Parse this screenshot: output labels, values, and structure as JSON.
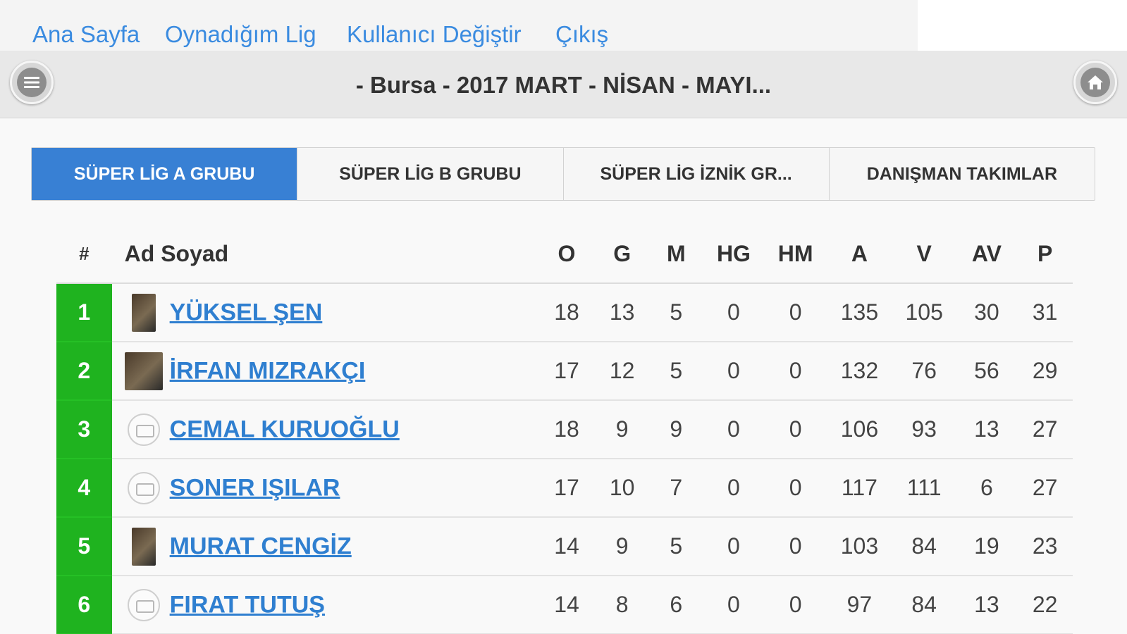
{
  "topnav": {
    "links": [
      "Ana Sayfa",
      "Oynadığım Lig",
      "Kullanıcı Değiştir",
      "Çıkış"
    ]
  },
  "header": {
    "title": "- Bursa - 2017 MART - NİSAN - MAYI...",
    "menu_icon": "hamburger-icon",
    "home_icon": "home-icon"
  },
  "tabs": [
    {
      "label": "SÜPER LİG A GRUBU",
      "active": true
    },
    {
      "label": "SÜPER LİG B GRUBU",
      "active": false
    },
    {
      "label": "SÜPER LİG İZNİK GR...",
      "active": false
    },
    {
      "label": "DANIŞMAN TAKIMLAR",
      "active": false
    }
  ],
  "table": {
    "headers": [
      "#",
      "Ad Soyad",
      "O",
      "G",
      "M",
      "HG",
      "HM",
      "A",
      "V",
      "AV",
      "P"
    ],
    "rows": [
      {
        "rank": "1",
        "name": "YÜKSEL ŞEN",
        "O": "18",
        "G": "13",
        "M": "5",
        "HG": "0",
        "HM": "0",
        "A": "135",
        "V": "105",
        "AV": "30",
        "P": "31"
      },
      {
        "rank": "2",
        "name": "İRFAN MIZRAKÇI",
        "O": "17",
        "G": "12",
        "M": "5",
        "HG": "0",
        "HM": "0",
        "A": "132",
        "V": "76",
        "AV": "56",
        "P": "29"
      },
      {
        "rank": "3",
        "name": "CEMAL KURUOĞLU",
        "O": "18",
        "G": "9",
        "M": "9",
        "HG": "0",
        "HM": "0",
        "A": "106",
        "V": "93",
        "AV": "13",
        "P": "27"
      },
      {
        "rank": "4",
        "name": "SONER IŞILAR",
        "O": "17",
        "G": "10",
        "M": "7",
        "HG": "0",
        "HM": "0",
        "A": "117",
        "V": "111",
        "AV": "6",
        "P": "27"
      },
      {
        "rank": "5",
        "name": "MURAT CENGİZ",
        "O": "14",
        "G": "9",
        "M": "5",
        "HG": "0",
        "HM": "0",
        "A": "103",
        "V": "84",
        "AV": "19",
        "P": "23"
      },
      {
        "rank": "6",
        "name": "FIRAT TUTUŞ",
        "O": "14",
        "G": "8",
        "M": "6",
        "HG": "0",
        "HM": "0",
        "A": "97",
        "V": "84",
        "AV": "13",
        "P": "22"
      }
    ]
  },
  "colors": {
    "link": "#3a8be0",
    "active_tab": "#3880d4",
    "rank_cell": "#1fb31f"
  }
}
